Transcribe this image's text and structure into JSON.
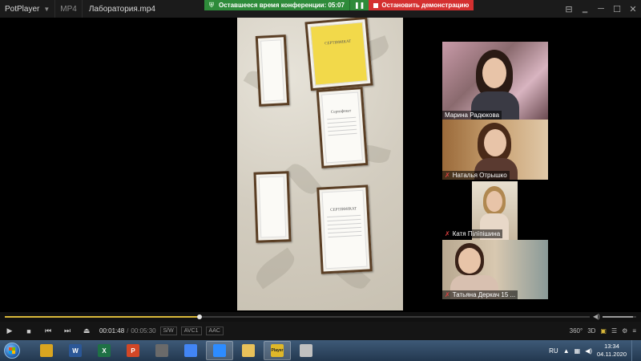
{
  "titlebar": {
    "app_name": "PotPlayer",
    "format": "MP4",
    "filename": "Лаборатория.mp4",
    "controls": [
      "⊟",
      "‗",
      "─",
      "☐",
      "✕"
    ]
  },
  "banner": {
    "timer_text": "Оставшееся время конференции: 05:07",
    "stop_text": "Остановить демонстрацию"
  },
  "shared": {
    "frames": [
      {
        "title": "",
        "gold": false
      },
      {
        "title": "СЕРТИФИКАТ",
        "gold": true
      },
      {
        "title": "Сертификат",
        "gold": false
      },
      {
        "title": "",
        "gold": false
      },
      {
        "title": "СЕРТИФИКАТ",
        "gold": false
      }
    ]
  },
  "participants": [
    {
      "name": "Марина Радюкова",
      "muted": false
    },
    {
      "name": "Наталья Отрышко",
      "muted": true
    },
    {
      "name": "Катя Пілїпішина",
      "muted": true
    },
    {
      "name": "Татьяна Деркач 15 ...",
      "muted": true
    }
  ],
  "playback": {
    "progress": 0.333,
    "volume": 0.9,
    "current_time": "00:01:48",
    "total_time": "00:05:30",
    "tags": [
      "S/W",
      "AVC1",
      "AAC"
    ],
    "right_labels": [
      "360°",
      "3D"
    ]
  },
  "taskbar": {
    "apps": [
      {
        "name": "explorer",
        "label": "",
        "color": "#d9a520"
      },
      {
        "name": "word",
        "label": "W",
        "color": "#2b5797"
      },
      {
        "name": "excel",
        "label": "X",
        "color": "#1e7145"
      },
      {
        "name": "powerpoint",
        "label": "P",
        "color": "#d24726"
      },
      {
        "name": "media",
        "label": "",
        "color": "#6a6a6a"
      },
      {
        "name": "chrome",
        "label": "",
        "color": "#4285f4"
      },
      {
        "name": "zoom",
        "label": "",
        "color": "#2d8cff"
      },
      {
        "name": "folder",
        "label": "",
        "color": "#e8c15a"
      },
      {
        "name": "potplayer",
        "label": "Player",
        "color": "#e0b828"
      },
      {
        "name": "paint",
        "label": "",
        "color": "#c0c0c0"
      }
    ],
    "lang": "RU",
    "time": "13:34",
    "date": "04.11.2020"
  }
}
